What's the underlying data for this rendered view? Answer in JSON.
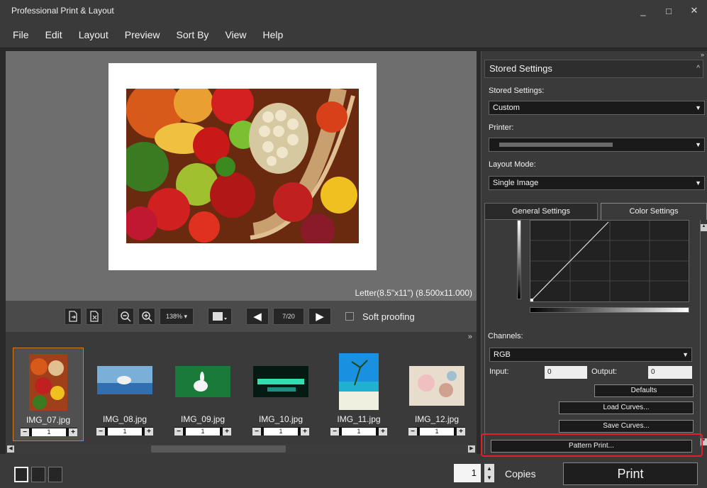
{
  "window": {
    "title": "Professional Print & Layout",
    "controls": {
      "minimize": "_",
      "maximize": "□",
      "close": "✕"
    }
  },
  "menu": [
    {
      "label": "File"
    },
    {
      "label": "Edit"
    },
    {
      "label": "Layout"
    },
    {
      "label": "Preview"
    },
    {
      "label": "Sort By"
    },
    {
      "label": "View"
    },
    {
      "label": "Help"
    }
  ],
  "preview": {
    "paper_size": "Letter(8.5\"x11\") (8.500x11.000)"
  },
  "toolbar": {
    "zoom": "138%",
    "page": "7/20",
    "soft_proofing": "Soft proofing"
  },
  "filmstrip": {
    "items": [
      {
        "name": "IMG_07.jpg",
        "copies": "1",
        "selected": true
      },
      {
        "name": "IMG_08.jpg",
        "copies": "1"
      },
      {
        "name": "IMG_09.jpg",
        "copies": "1"
      },
      {
        "name": "IMG_10.jpg",
        "copies": "1"
      },
      {
        "name": "IMG_11.jpg",
        "copies": "1"
      },
      {
        "name": "IMG_12.jpg",
        "copies": "1"
      }
    ]
  },
  "bottom": {
    "copies_value": "1",
    "copies_label": "Copies",
    "print_label": "Print"
  },
  "panel": {
    "header": "Stored Settings",
    "stored_settings_label": "Stored Settings:",
    "stored_settings_value": "Custom",
    "printer_label": "Printer:",
    "printer_value": "",
    "layout_mode_label": "Layout Mode:",
    "layout_mode_value": "Single Image",
    "tab_general": "General Settings",
    "tab_color": "Color Settings",
    "channels_label": "Channels:",
    "channels_value": "RGB",
    "input_label": "Input:",
    "input_value": "0",
    "output_label": "Output:",
    "output_value": "0",
    "defaults_label": "Defaults",
    "load_curves_label": "Load Curves...",
    "save_curves_label": "Save Curves...",
    "pattern_print_label": "Pattern Print..."
  },
  "colors": {
    "highlight": "#e0202a",
    "selection": "#d47a22"
  }
}
